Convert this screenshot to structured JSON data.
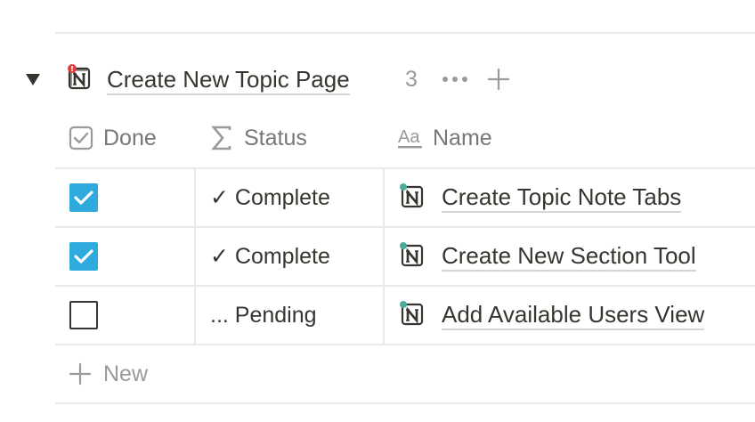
{
  "group": {
    "title": "Create New Topic Page",
    "count": "3",
    "icon": "notion-page-icon",
    "badge_color": "#e03e3e"
  },
  "columns": [
    {
      "label": "Done",
      "icon": "checkbox-property-icon"
    },
    {
      "label": "Status",
      "icon": "sigma-formula-icon"
    },
    {
      "label": "Name",
      "icon": "text-property-icon"
    }
  ],
  "rows": [
    {
      "done": true,
      "status": "✓ Complete",
      "name": "Create Topic Note Tabs"
    },
    {
      "done": true,
      "status": "✓ Complete",
      "name": "Create New Section Tool"
    },
    {
      "done": false,
      "status": "... Pending",
      "name": "Add Available Users View"
    }
  ],
  "new_row": {
    "label": "New"
  },
  "colors": {
    "checkbox_checked": "#2eaadc",
    "row_icon_dot": "#4dab9a",
    "muted_text": "#9b9a97",
    "border": "#e9e9e7"
  }
}
